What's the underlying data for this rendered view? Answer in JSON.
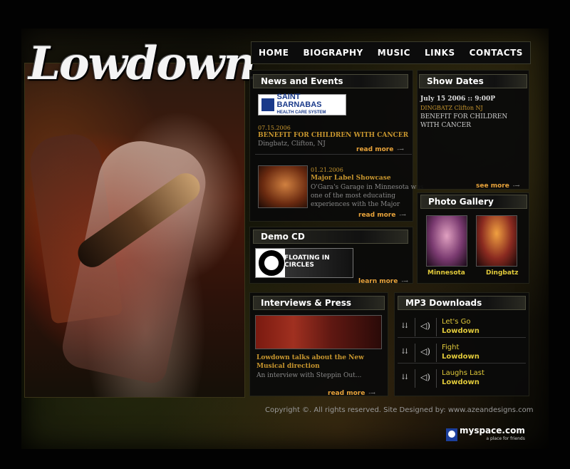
{
  "brand": {
    "logo": "Lowdown"
  },
  "nav": {
    "items": [
      "HOME",
      "BIOGRAPHY",
      "MUSIC",
      "LINKS",
      "CONTACTS"
    ]
  },
  "news": {
    "heading": "News and Events",
    "sponsor_logo": {
      "line1": "SAINT BARNABAS",
      "line2": "HEALTH CARE SYSTEM"
    },
    "items": [
      {
        "date": "07.15.2006",
        "title": "BENEFIT FOR CHILDREN WITH CANCER",
        "location": "Dingbatz, Clifton, NJ",
        "more": "read more"
      },
      {
        "date": "01.21.2006",
        "title": "Major Label Showcase",
        "desc1": "O'Gara's Garage in Minnesota was",
        "desc2": "one of the most educating",
        "desc3": "experiences with the Major",
        "more": "read more"
      }
    ]
  },
  "shows": {
    "heading": "Show Dates",
    "line1": "July 15 2006 :: 9:00P",
    "line2": "DINGBATZ Clifton NJ",
    "line3": "BENEFIT FOR CHILDREN",
    "line4": "WITH CANCER",
    "more": "see more"
  },
  "gallery": {
    "heading": "Photo Gallery",
    "items": [
      {
        "label": "Minnesota"
      },
      {
        "label": "Dingbatz"
      }
    ]
  },
  "demo": {
    "heading": "Demo CD",
    "banner": "FLOATING IN CIRCLES",
    "more": "learn more"
  },
  "interviews": {
    "heading": "Interviews & Press",
    "title1": "Lowdown talks about the New",
    "title2": "Musical direction",
    "desc": "An interview with Steppin Out...",
    "more": "read more"
  },
  "mp3": {
    "heading": "MP3 Downloads",
    "tracks": [
      {
        "title": "Let's Go",
        "artist": "Lowdown"
      },
      {
        "title": "Fight",
        "artist": "Lowdown"
      },
      {
        "title": "Laughs Last",
        "artist": "Lowdown"
      }
    ]
  },
  "footer": {
    "text": "Copyright ©. All rights reserved. Site Designed by: www.azeandesigns.com"
  },
  "myspace": {
    "name": "myspace.com",
    "tagline": "a place for friends"
  },
  "colors": {
    "accent": "#e8a33a",
    "gold": "#c8962e",
    "label": "#e0c93a"
  }
}
